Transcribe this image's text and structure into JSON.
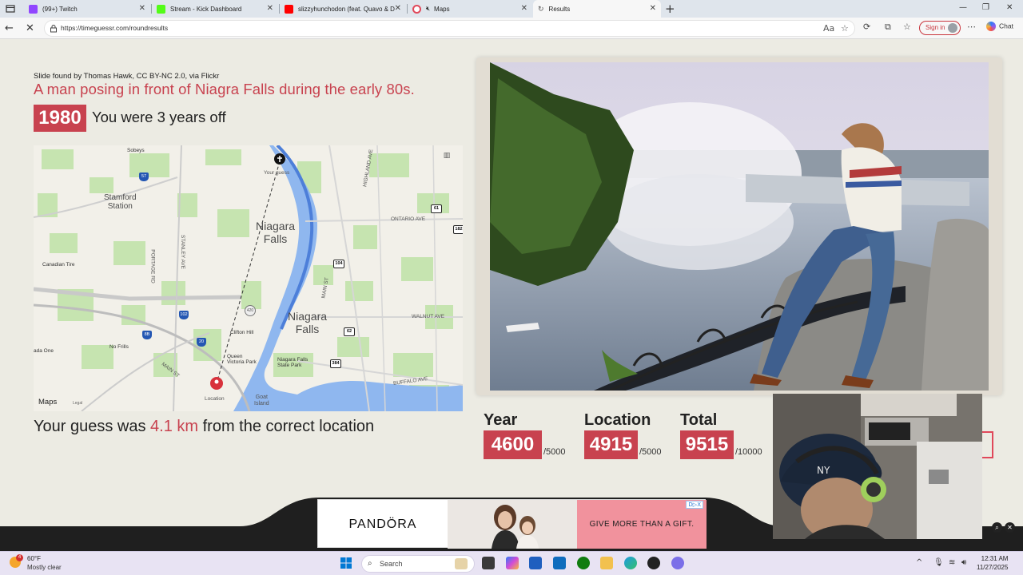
{
  "browser": {
    "tabs": [
      {
        "title": "(99+) Twitch",
        "color": "#9146ff"
      },
      {
        "title": "Stream - Kick Dashboard",
        "color": "#53fc18"
      },
      {
        "title": "slizzyhunchodon (feat. Quavo & D",
        "color": "#ff0000"
      },
      {
        "title": "Maps",
        "color": "#e0485a"
      },
      {
        "title": "Results",
        "color": "#888888"
      }
    ],
    "url": "https://timeguessr.com/roundresults",
    "signin_label": "Sign in",
    "chat_label": "Chat"
  },
  "round": {
    "credit": "Slide found by Thomas Hawk, CC BY-NC 2.0, via Flickr",
    "caption": "A man posing in front of Niagra Falls during the early 80s.",
    "year": "1980",
    "off_text": "You were 3 years off",
    "distance_prefix": "Your guess was ",
    "distance_value": "4.1 km",
    "distance_suffix": " from the correct location"
  },
  "map": {
    "labels": {
      "stamford": "Stamford\nStation",
      "niagara_falls_1": "Niagara\nFalls",
      "niagara_falls_2": "Niagara\nFalls",
      "ontario_ave": "ONTARIO AVE",
      "walnut_ave": "WALNUT AVE",
      "buffalo_ave": "BUFFALO AVE",
      "main_st": "MAIN ST",
      "stanley_ave": "STANLEY AVE",
      "portage_rd": "PORTAGE RD",
      "highland_ave": "HIGHLAND AVE",
      "main_st_2": "MAIN ST",
      "goat_island": "Goat\nIsland",
      "sobeys": "Sobeys",
      "canadian_tire": "Canadian Tire",
      "no_frills": "No Frills",
      "clifton_hill": "Clifton Hill",
      "queen_victoria_park": "Queen\nVictoria Park",
      "niagara_falls_state_park": "Niagara Falls\nState Park",
      "ada_one": "ada One",
      "your_guess": "Your guess",
      "location": "Location",
      "maps_brand": "Maps",
      "legal": "Legal"
    },
    "shields": [
      "57",
      "61",
      "182",
      "104",
      "62",
      "384",
      "420",
      "102",
      "20",
      "8B"
    ]
  },
  "scores": {
    "year": {
      "label": "Year",
      "value": "4600",
      "max": "/5000"
    },
    "location": {
      "label": "Location",
      "value": "4915",
      "max": "/5000"
    },
    "total": {
      "label": "Total",
      "value": "9515",
      "max": "/10000"
    }
  },
  "ad": {
    "brand": "PANDÖRA",
    "tagline": "GIVE MORE THAN A GIFT.",
    "badge": "D▷X"
  },
  "taskbar": {
    "weather_temp": "60°F",
    "weather_cond": "Mostly clear",
    "weather_badge": "4",
    "search_placeholder": "Search",
    "time": "12:31 AM",
    "date": "11/27/2025"
  },
  "colors": {
    "accent": "#c8424f",
    "page_bg": "#ecebe3"
  }
}
